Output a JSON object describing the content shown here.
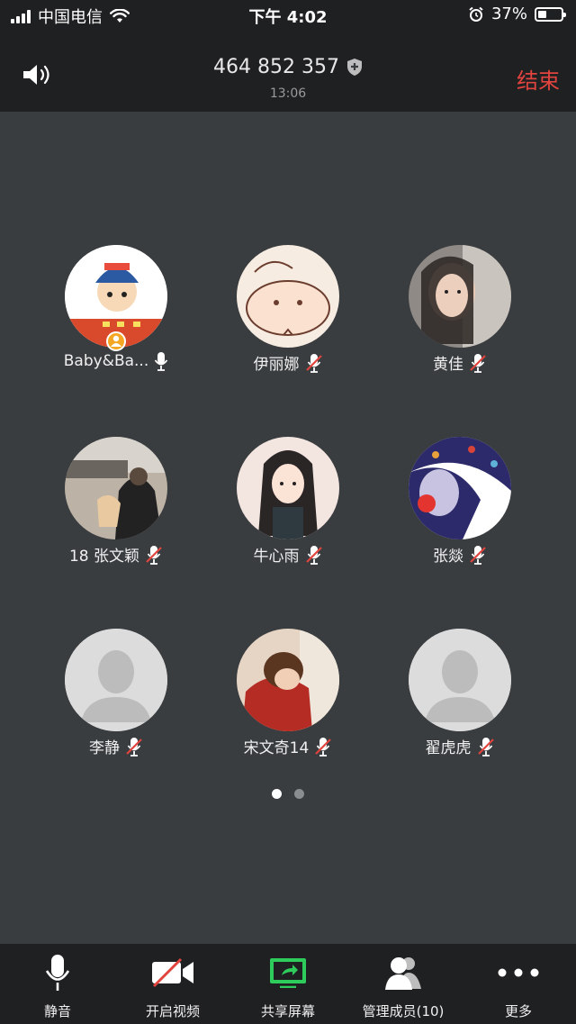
{
  "status_bar": {
    "carrier": "中国电信",
    "time": "下午 4:02",
    "battery": "37%",
    "battery_level": 0.37
  },
  "meeting": {
    "id": "464 852 357",
    "elapsed": "13:06",
    "end_label": "结束"
  },
  "participants": [
    {
      "name": "Baby&Ba...",
      "mic": "on",
      "host": true
    },
    {
      "name": "伊丽娜",
      "mic": "muted"
    },
    {
      "name": "黄佳",
      "mic": "muted"
    },
    {
      "name": "18 张文颖",
      "mic": "muted"
    },
    {
      "name": "牛心雨",
      "mic": "muted"
    },
    {
      "name": "张燚",
      "mic": "muted"
    },
    {
      "name": "李静",
      "mic": "muted"
    },
    {
      "name": "宋文奇14",
      "mic": "muted"
    },
    {
      "name": "翟虎虎",
      "mic": "muted"
    }
  ],
  "pagination": {
    "pages": 2,
    "current": 1
  },
  "toolbar": {
    "mute": "静音",
    "video": "开启视频",
    "share": "共享屏幕",
    "manage": "管理成员(10)",
    "more": "更多"
  },
  "colors": {
    "accent_end": "#e0443e",
    "share_green": "#2ecc5a",
    "host_badge": "#f5a623"
  }
}
